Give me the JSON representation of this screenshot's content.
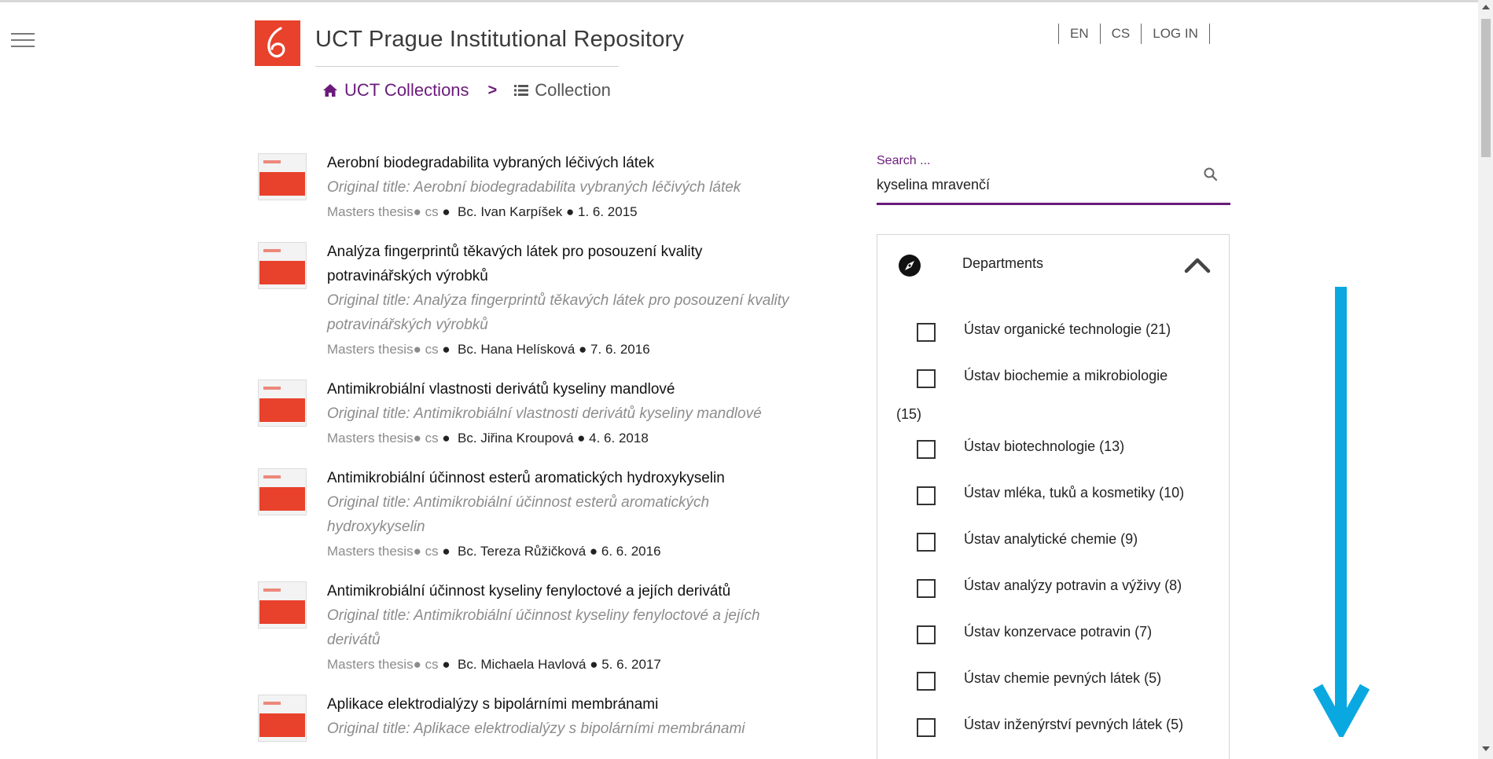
{
  "header": {
    "site_title": "UCT Prague Institutional Repository",
    "lang_en": "EN",
    "lang_cs": "CS",
    "login": "LOG IN"
  },
  "breadcrumb": {
    "home": "UCT Collections",
    "separator": ">",
    "current": "Collection"
  },
  "search": {
    "label": "Search ...",
    "value": "kyselina mravenčí"
  },
  "results": [
    {
      "title": "Aerobní biodegradabilita vybraných léčivých látek",
      "original": "Original title: Aerobní biodegradabilita vybraných léčivých látek",
      "type": "Masters thesis",
      "lang": "cs",
      "author": "Bc. Ivan Karpíšek",
      "date": "1. 6. 2015"
    },
    {
      "title": "Analýza fingerprintů těkavých látek pro posouzení kvality potravinářských výrobků",
      "original": "Original title: Analýza fingerprintů těkavých látek pro posouzení kvality potravinářských výrobků",
      "type": "Masters thesis",
      "lang": "cs",
      "author": "Bc. Hana Helísková",
      "date": "7. 6. 2016"
    },
    {
      "title": "Antimikrobiální vlastnosti derivátů kyseliny mandlové",
      "original": "Original title: Antimikrobiální vlastnosti derivátů kyseliny mandlové",
      "type": "Masters thesis",
      "lang": "cs",
      "author": "Bc. Jiřina Kroupová",
      "date": "4. 6. 2018"
    },
    {
      "title": "Antimikrobiální účinnost esterů aromatických hydroxykyselin",
      "original": "Original title: Antimikrobiální účinnost esterů aromatických hydroxykyselin",
      "type": "Masters thesis",
      "lang": "cs",
      "author": "Bc. Tereza Růžičková",
      "date": "6. 6. 2016"
    },
    {
      "title": "Antimikrobiální účinnost kyseliny fenyloctové a jejích derivátů",
      "original": "Original title: Antimikrobiální účinnost kyseliny fenyloctové a jejích derivátů",
      "type": "Masters thesis",
      "lang": "cs",
      "author": "Bc. Michaela Havlová",
      "date": "5. 6. 2017"
    },
    {
      "title": "Aplikace elektrodialýzy s bipolárními membránami",
      "original": "Original title: Aplikace elektrodialýzy s bipolárními membránami",
      "type": "",
      "lang": "",
      "author": "",
      "date": ""
    }
  ],
  "facet": {
    "title": "Departments",
    "options": [
      "Ústav organické technologie (21)",
      "Ústav biochemie a mikrobiologie",
      "(15)",
      "Ústav biotechnologie (13)",
      "Ústav mléka, tuků a kosmetiky (10)",
      "Ústav analytické chemie (9)",
      "Ústav analýzy potravin a výživy (8)",
      "Ústav konzervace potravin (7)",
      "Ústav chemie pevných látek (5)",
      "Ústav inženýrství pevných látek (5)"
    ]
  },
  "colors": {
    "accent": "#6a1b7a",
    "brand": "#e8412c",
    "annotation_arrow": "#0aa8e0"
  },
  "icons": [
    "menu-icon",
    "logo-icon",
    "home-icon",
    "list-icon",
    "search-icon",
    "compass-icon",
    "chevron-up-icon"
  ]
}
